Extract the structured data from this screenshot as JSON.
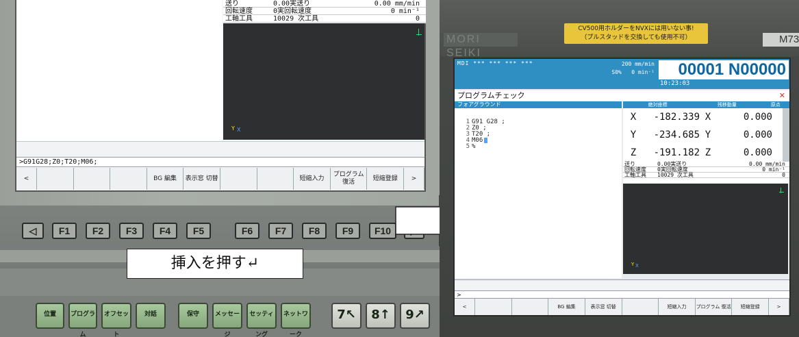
{
  "left": {
    "table": [
      [
        "送り",
        "0.00実送り",
        "0.00 mm/min"
      ],
      [
        "回転速度",
        "0実回転速度",
        "0 min⁻¹"
      ],
      [
        "工軸工具",
        "10029 次工具",
        "0"
      ]
    ],
    "view_axis_y": "Y",
    "view_axis_x": "X",
    "command_line": ">G91G28;Z0;T20;M06;",
    "softkeys": [
      "<",
      "",
      "",
      "",
      "BG 編集",
      "表示窓 切替",
      "",
      "",
      "短縮入力",
      "プログラム 復活",
      "短縮登録",
      ">"
    ],
    "fkeys": [
      "◁",
      "F1",
      "F2",
      "F3",
      "F4",
      "F5",
      "F6",
      "F7",
      "F8",
      "F9",
      "F10",
      "▷"
    ],
    "callout": "挿入を押す↵",
    "panel_keys": [
      "位置",
      "プログラム",
      "オフセット",
      "対話",
      "保守",
      "メッセージ",
      "セッティング",
      "ネットワーク",
      "7↖",
      "8↑",
      "9↗"
    ]
  },
  "right": {
    "logo": "MORI SEIKI",
    "warning": [
      "CV500用ホルダーをNVXには用いない事!",
      "（プルスタッドを交換しても使用不可）"
    ],
    "model": "M73",
    "status_line": "MDI  ***  ***  ***     ***",
    "feed": "200 mm/min",
    "override": "S0%",
    "spindle": "0 min⁻¹",
    "program_no": "00001 N00000",
    "time": "10:23:03",
    "screen_title": "プログラムチェック",
    "tab_label": "フォアグラウンド",
    "program_lines": [
      {
        "no": "1",
        "text": "G91 G28 ;"
      },
      {
        "no": "2",
        "text": "Z0 ;"
      },
      {
        "no": "3",
        "text": "T20 ;"
      },
      {
        "no": "4",
        "text": "M06"
      },
      {
        "no": "5",
        "text": "%"
      }
    ],
    "coord_headers": [
      "絶対座標",
      "残移動量",
      "原点"
    ],
    "coords": [
      {
        "axis": "X",
        "abs": "-182.339",
        "axis2": "X",
        "rem": "0.000"
      },
      {
        "axis": "Y",
        "abs": "-234.685",
        "axis2": "Y",
        "rem": "0.000"
      },
      {
        "axis": "Z",
        "abs": "-191.182",
        "axis2": "Z",
        "rem": "0.000"
      }
    ],
    "mini_table": [
      [
        "送り",
        "0.00実送り",
        "0.00 mm/min"
      ],
      [
        "回転速度",
        "0実回転速度",
        "0 min⁻¹"
      ],
      [
        "工軸工具",
        "10029 次工具",
        "0"
      ]
    ],
    "view_axis_y": "Y",
    "view_axis_x": "X",
    "command_line": ">",
    "softkeys": [
      "<",
      "",
      "",
      "BG 編集",
      "表示窓 切替",
      "",
      "短縮入力",
      "プログラム 復活",
      "短縮登録",
      ">"
    ]
  }
}
